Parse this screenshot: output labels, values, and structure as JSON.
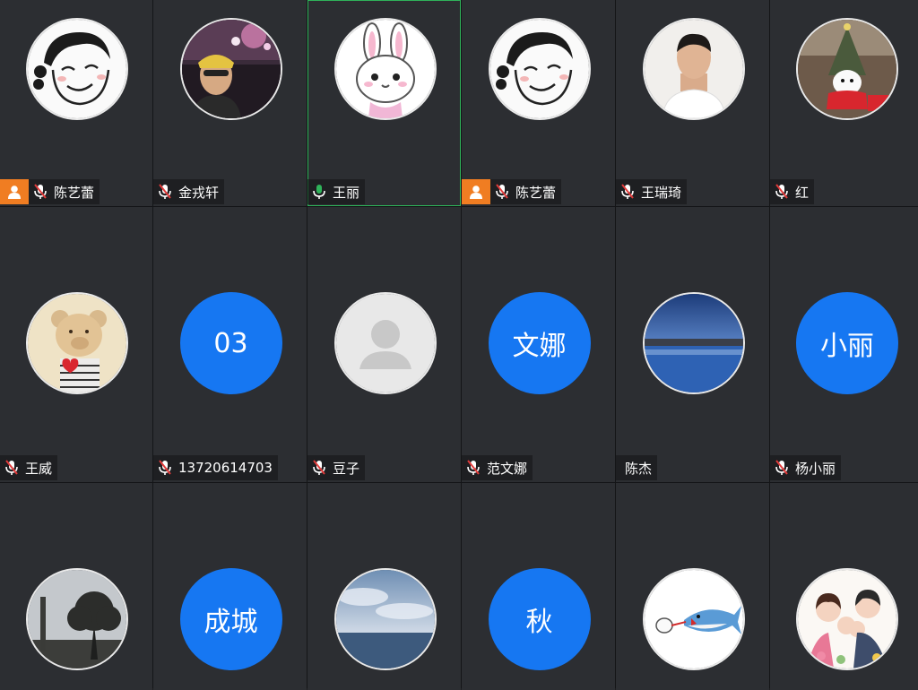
{
  "participants": [
    {
      "name": "陈艺蕾",
      "avatar": "cartoon-girl-sketch",
      "host": true,
      "mic": "muted",
      "speaking": false
    },
    {
      "name": "金戎轩",
      "avatar": "photo-man-concert",
      "host": false,
      "mic": "muted",
      "speaking": false
    },
    {
      "name": "王丽",
      "avatar": "cartoon-bunny",
      "host": false,
      "mic": "active",
      "speaking": true
    },
    {
      "name": "陈艺蕾",
      "avatar": "cartoon-girl-sketch",
      "host": true,
      "mic": "muted",
      "speaking": false
    },
    {
      "name": "王瑞琦",
      "avatar": "photo-young-man",
      "host": false,
      "mic": "muted",
      "speaking": false
    },
    {
      "name": "红",
      "avatar": "photo-snowman-tree",
      "host": false,
      "mic": "muted",
      "speaking": false
    },
    {
      "name": "王威",
      "avatar": "photo-teddy-bear",
      "host": false,
      "mic": "muted",
      "speaking": false
    },
    {
      "name": "13720614703",
      "avatar": "text",
      "avatar_text": "03",
      "host": false,
      "mic": "muted",
      "speaking": false
    },
    {
      "name": "豆子",
      "avatar": "default-person",
      "host": false,
      "mic": "muted",
      "speaking": false
    },
    {
      "name": "范文娜",
      "avatar": "text",
      "avatar_text": "文娜",
      "host": false,
      "mic": "muted",
      "speaking": false
    },
    {
      "name": "陈杰",
      "avatar": "photo-lake-dusk",
      "host": false,
      "mic": "none",
      "speaking": false
    },
    {
      "name": "杨小丽",
      "avatar": "text",
      "avatar_text": "小丽",
      "host": false,
      "mic": "muted",
      "speaking": false
    },
    {
      "name": "",
      "avatar": "photo-tree-silhouette",
      "host": false,
      "mic": "none",
      "speaking": false
    },
    {
      "name": "",
      "avatar": "text",
      "avatar_text": "成城",
      "host": false,
      "mic": "none",
      "speaking": false
    },
    {
      "name": "",
      "avatar": "photo-cloudy-sea",
      "host": false,
      "mic": "none",
      "speaking": false
    },
    {
      "name": "",
      "avatar": "text",
      "avatar_text": "秋",
      "host": false,
      "mic": "none",
      "speaking": false
    },
    {
      "name": "",
      "avatar": "cartoon-shark-cat",
      "host": false,
      "mic": "none",
      "speaking": false
    },
    {
      "name": "",
      "avatar": "cartoon-family",
      "host": false,
      "mic": "none",
      "speaking": false
    }
  ],
  "colors": {
    "tile_bg": "#2c2e32",
    "avatar_blue": "#1677f2",
    "host_orange": "#f07d22",
    "mic_active_green": "#2fb35a",
    "mic_muted_red": "#e23b3b"
  }
}
